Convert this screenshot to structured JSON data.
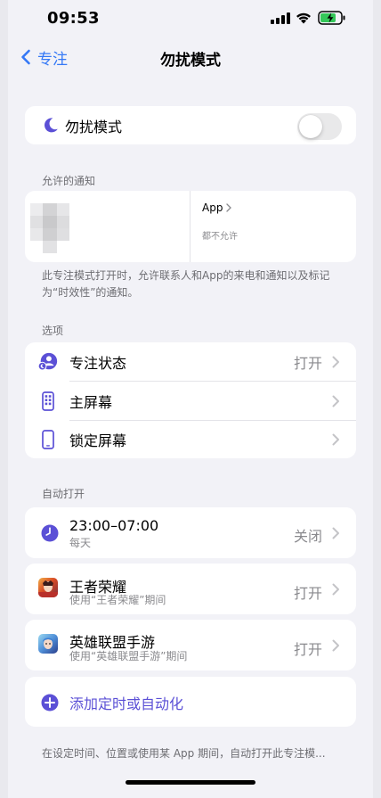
{
  "status_bar": {
    "time": "09:53"
  },
  "nav": {
    "back_label": "专注",
    "title": "勿扰模式"
  },
  "dnd_toggle": {
    "label": "勿扰模式",
    "enabled": false,
    "accent": "#5b50d6"
  },
  "allowed_notifications": {
    "header": "允许的通知",
    "apps_label": "App",
    "apps_value": "都不允许",
    "footer": "此专注模式打开时，允许联系人和App的来电和通知以及标记为“时效性”的通知。"
  },
  "options": {
    "header": "选项",
    "items": [
      {
        "label": "专注状态",
        "value": "打开",
        "icon": "focus-status-icon"
      },
      {
        "label": "主屏幕",
        "value": "",
        "icon": "home-screen-icon"
      },
      {
        "label": "锁定屏幕",
        "value": "",
        "icon": "lock-screen-icon"
      }
    ]
  },
  "auto_on": {
    "header": "自动打开",
    "schedule": {
      "time": "23:00–07:00",
      "repeat": "每天",
      "value": "关闭",
      "icon": "clock-icon"
    },
    "apps": [
      {
        "name": "王者荣耀",
        "detail": "使用“王者荣耀”期间",
        "value": "打开",
        "icon": "honor-of-kings-app-icon"
      },
      {
        "name": "英雄联盟手游",
        "detail": "使用“英雄联盟手游”期间",
        "value": "打开",
        "icon": "lol-mobile-app-icon"
      }
    ],
    "add_label": "添加定时或自动化",
    "footer": "在设定时间、位置或使用某 App 期间，自动打开此专注模..."
  },
  "colors": {
    "accent": "#3478f6",
    "purple": "#5b50d6",
    "background": "#f2f2f7"
  }
}
